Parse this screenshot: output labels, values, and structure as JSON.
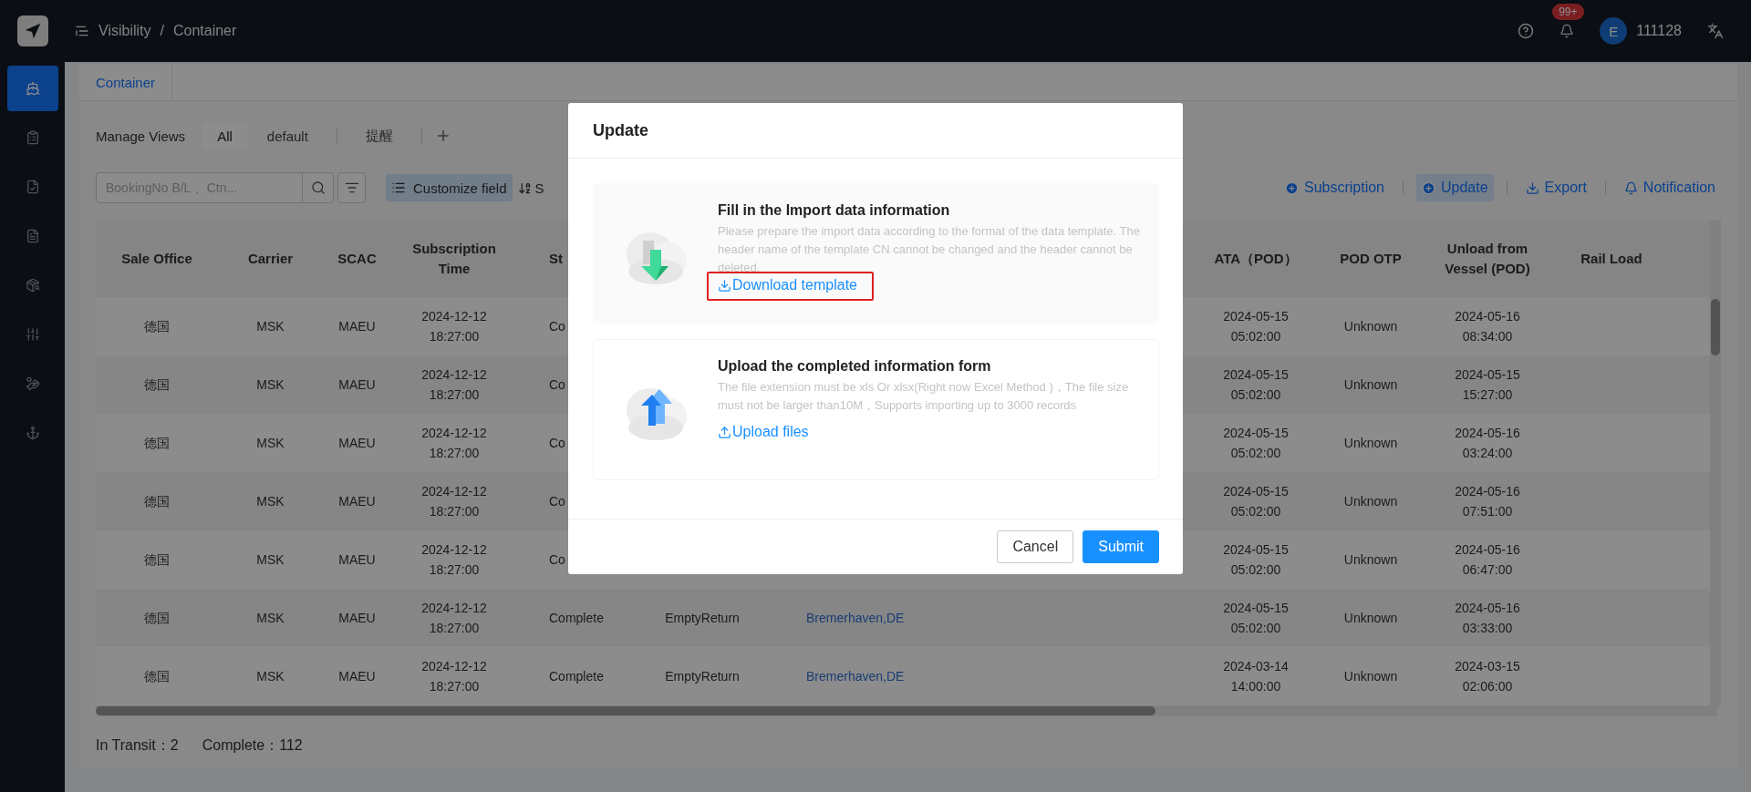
{
  "topbar": {
    "breadcrumb": [
      "Visibility",
      "Container"
    ],
    "separator": "/",
    "badge": "99+",
    "avatar": "E",
    "user": "111128"
  },
  "sidebar": {
    "items": [
      {
        "selected": true
      },
      {
        "selected": false
      },
      {
        "selected": false
      },
      {
        "selected": false
      },
      {
        "selected": false
      },
      {
        "selected": false
      },
      {
        "selected": false
      },
      {
        "selected": false
      }
    ]
  },
  "page_tabs": [
    {
      "label": "Container",
      "selected": true
    }
  ],
  "views": {
    "label": "Manage Views",
    "tabs": [
      {
        "label": "All",
        "selected": true
      },
      {
        "label": "default",
        "selected": false
      },
      {
        "label": "提醒",
        "selected": false
      }
    ]
  },
  "toolbar": {
    "search": {
      "placeholder": "BookingNo B/L 、Ctn..."
    },
    "customize": {
      "label": "Customize field",
      "selected": true
    },
    "sort_label": "S",
    "actions": [
      {
        "label": "Subscription",
        "selected": false
      },
      {
        "label": "Update",
        "selected": true
      },
      {
        "label": "Export",
        "selected": false
      },
      {
        "label": "Notification",
        "selected": false
      }
    ]
  },
  "table": {
    "columns": [
      {
        "label": "Sale Office",
        "kind": "text"
      },
      {
        "label": "Carrier",
        "kind": "text"
      },
      {
        "label": "SCAC",
        "kind": "text"
      },
      {
        "label": "Subscription Time",
        "kind": "text"
      },
      {
        "label": "St",
        "kind": "status"
      },
      {
        "kind": "text"
      },
      {
        "kind": "link"
      },
      {
        "label": "ATA（POD）",
        "kind": "text"
      },
      {
        "label": "POD OTP",
        "kind": "text"
      },
      {
        "label": "Unload from Vessel (POD)",
        "kind": "text"
      },
      {
        "label": "Rail Load",
        "kind": "text"
      }
    ],
    "rows": [
      {
        "cells": [
          "德国",
          "MSK",
          "MAEU",
          "2024-12-12 18:27:00",
          "Co",
          null,
          null,
          "2024-05-15 05:02:00",
          "Unknown",
          "2024-05-16 08:34:00",
          null
        ]
      },
      {
        "cells": [
          "德国",
          "MSK",
          "MAEU",
          "2024-12-12 18:27:00",
          "Co",
          null,
          null,
          "2024-05-15 05:02:00",
          "Unknown",
          "2024-05-15 15:27:00",
          null
        ]
      },
      {
        "cells": [
          "德国",
          "MSK",
          "MAEU",
          "2024-12-12 18:27:00",
          "Co",
          null,
          null,
          "2024-05-15 05:02:00",
          "Unknown",
          "2024-05-16 03:24:00",
          null
        ]
      },
      {
        "cells": [
          "德国",
          "MSK",
          "MAEU",
          "2024-12-12 18:27:00",
          "Co",
          null,
          null,
          "2024-05-15 05:02:00",
          "Unknown",
          "2024-05-16 07:51:00",
          null
        ]
      },
      {
        "cells": [
          "德国",
          "MSK",
          "MAEU",
          "2024-12-12 18:27:00",
          "Co",
          null,
          null,
          "2024-05-15 05:02:00",
          "Unknown",
          "2024-05-16 06:47:00",
          null
        ]
      },
      {
        "cells": [
          "德国",
          "MSK",
          "MAEU",
          "2024-12-12 18:27:00",
          "Complete",
          "EmptyReturn",
          "Bremerhaven,DE",
          "2024-05-15 05:02:00",
          "Unknown",
          "2024-05-16 03:33:00",
          null
        ]
      },
      {
        "cells": [
          "德国",
          "MSK",
          "MAEU",
          "2024-12-12 18:27:00",
          "Complete",
          "EmptyReturn",
          "Bremerhaven,DE",
          "2024-03-14 14:00:00",
          "Unknown",
          "2024-03-15 02:06:00",
          null
        ]
      }
    ]
  },
  "summary": [
    "In Transit：2",
    "Complete：112"
  ],
  "modal": {
    "title": "Update",
    "sections": [
      {
        "kind": "download",
        "title": "Fill in the Import data information",
        "description": "Please prepare the import data according to the format of the data template. The header name of the template CN cannot be changed and the header cannot be deleted.",
        "link": "Download template",
        "highlighted": true
      },
      {
        "kind": "upload",
        "title": "Upload the completed information form",
        "description": "The file extension must be xls Or xlsx(Right now Excel Method )，The file size must not be larger than10M，Supports importing up to 3000 records",
        "link": "Upload files",
        "highlighted": false
      }
    ],
    "buttons": [
      {
        "label": "Cancel",
        "kind": "default"
      },
      {
        "label": "Submit",
        "kind": "primary"
      }
    ]
  }
}
